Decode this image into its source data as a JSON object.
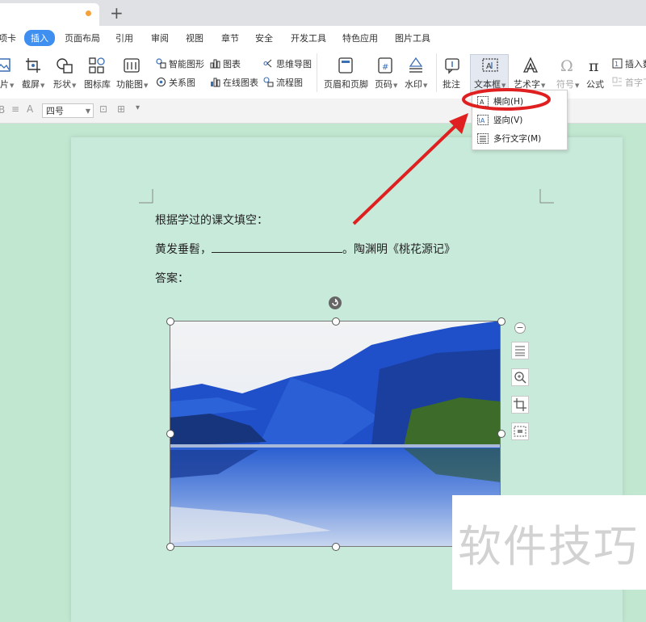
{
  "menu": {
    "items": [
      "项卡",
      "插入",
      "页面布局",
      "引用",
      "审阅",
      "视图",
      "章节",
      "安全",
      "开发工具",
      "特色应用",
      "图片工具"
    ]
  },
  "ribbon": {
    "picture": "片",
    "screenshot": "截屏",
    "shapes": "形状",
    "icon_library": "图标库",
    "function_chart": "功能图",
    "smart_graphic": "智能图形",
    "chart": "图表",
    "mind_map": "思维导图",
    "relation_chart": "关系图",
    "online_chart": "在线图表",
    "flowchart": "流程图",
    "header_footer": "页眉和页脚",
    "page_number": "页码",
    "watermark": "水印",
    "comment": "批注",
    "text_box": "文本框",
    "art_text": "艺术字",
    "symbol": "符号",
    "formula": "公式",
    "insert_number": "插入数",
    "drop_cap": "首字下"
  },
  "format_bar": {
    "font_size": "四号"
  },
  "dropdown": {
    "items": [
      "横向(H)",
      "竖向(V)",
      "多行文字(M)"
    ],
    "highlighted": "横向(H)"
  },
  "document": {
    "line1": "根据学过的课文填空：",
    "line2_prefix": "黄发垂髫，",
    "line2_suffix": "。陶渊明《桃花源记》",
    "line3": "答案："
  },
  "watermark_text": "软件技巧",
  "colors": {
    "accent": "#3f8ff0",
    "annotation_red": "#e02020",
    "page_bg": "#c8eada"
  }
}
